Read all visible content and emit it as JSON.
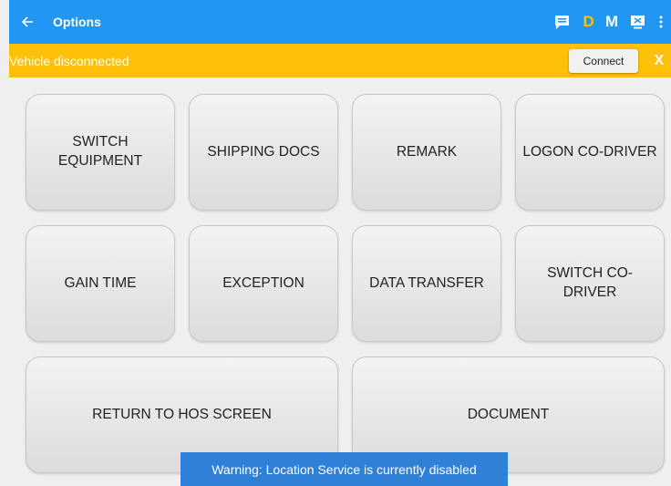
{
  "header": {
    "title": "Options",
    "icons": [
      "back-arrow-icon",
      "message-icon",
      "more-vert-icon",
      "device-icon"
    ],
    "d_label": "D",
    "m_label": "M",
    "color": "#2196f3"
  },
  "banner": {
    "message": "Vehicle disconnected",
    "connect_label": "Connect",
    "close_label": "X",
    "color": "#ffc107"
  },
  "tiles": {
    "switch_equipment": "SWITCH EQUIPMENT",
    "shipping_docs": "SHIPPING DOCS",
    "remark": "REMARK",
    "logon_co_driver": "LOGON CO-DRIVER",
    "gain_time": "GAIN TIME",
    "exception": "EXCEPTION",
    "data_transfer": "DATA TRANSFER",
    "switch_co_driver": "SWITCH CO-DRIVER",
    "return_to_hos": "RETURN TO HOS SCREEN",
    "document": "DOCUMENT"
  },
  "toast": {
    "message": "Warning: Location Service is currently disabled",
    "color": "#2f80d6"
  }
}
